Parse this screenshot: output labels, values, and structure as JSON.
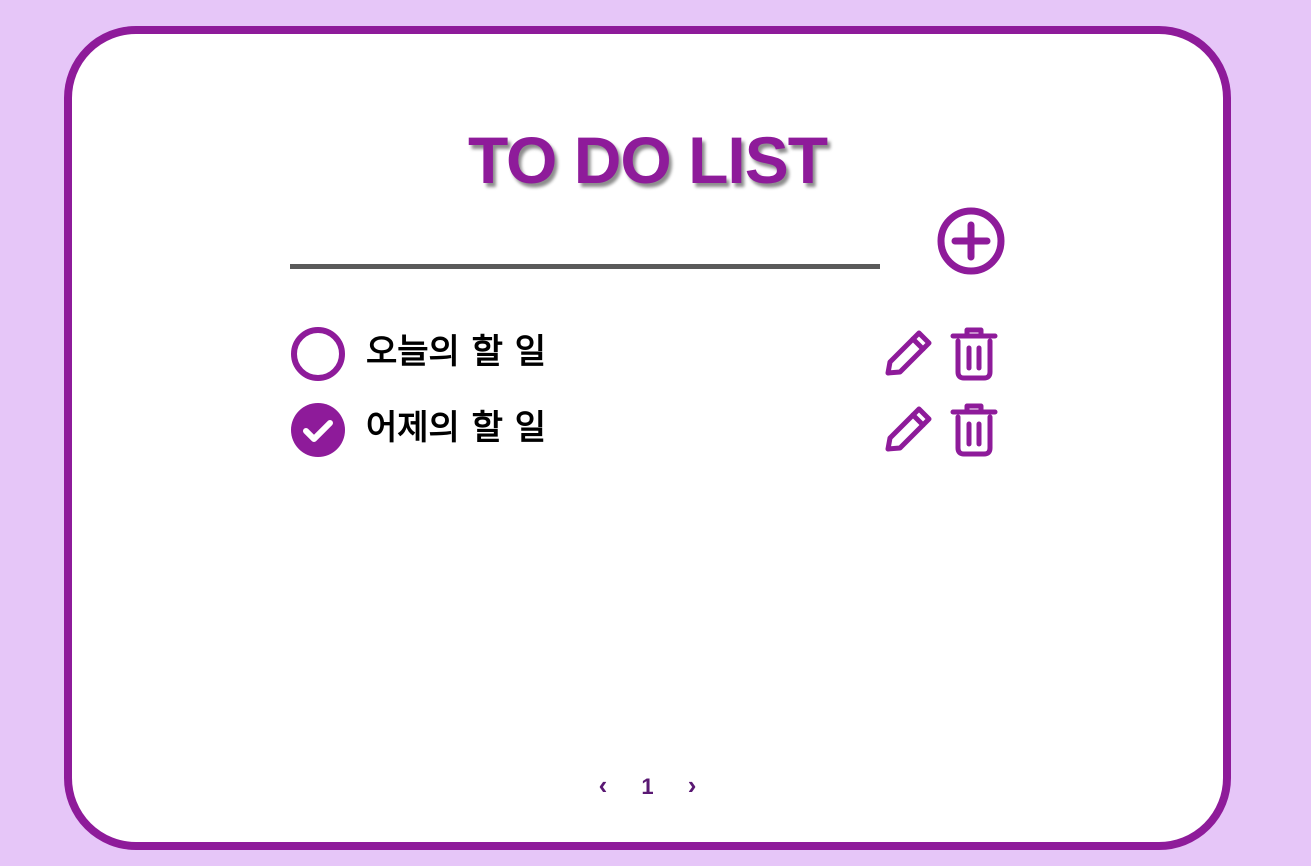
{
  "app": {
    "title": "TO DO LIST"
  },
  "new_todo": {
    "value": "",
    "placeholder": ""
  },
  "todos": [
    {
      "text": "오늘의 할 일",
      "done": false
    },
    {
      "text": "어제의 할 일",
      "done": true
    }
  ],
  "pagination": {
    "prev": "‹",
    "current": "1",
    "next": "›"
  },
  "icons": {
    "add": "plus-circle-icon",
    "unchecked": "circle-outline-icon",
    "checked": "check-circle-icon",
    "edit": "pencil-icon",
    "delete": "trash-icon"
  },
  "colors": {
    "background": "#e6c6f8",
    "accent": "#8e1b9a",
    "card": "#ffffff",
    "underline": "#5a5a5a",
    "pagination": "#5a1873"
  }
}
